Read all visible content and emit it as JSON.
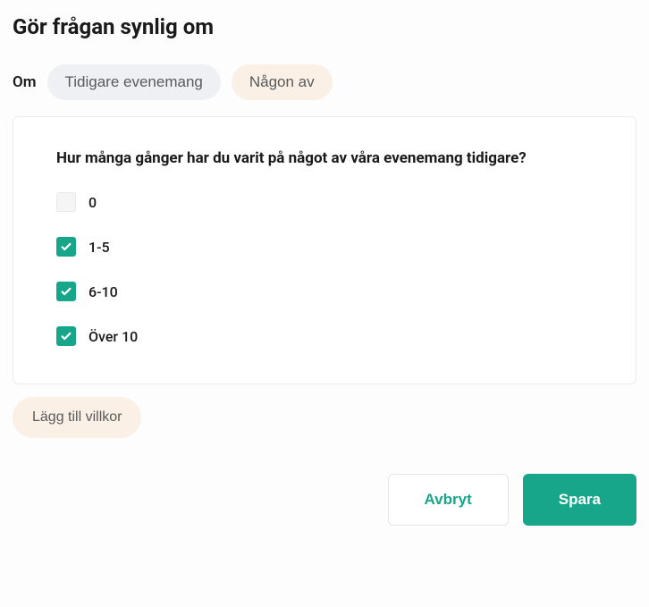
{
  "heading": "Gör frågan synlig om",
  "condition": {
    "prefix": "Om",
    "field": "Tidigare evenemang",
    "operator": "Någon av"
  },
  "question": "Hur många gånger har du varit på något av våra evenemang tidigare?",
  "options": [
    {
      "label": "0",
      "checked": false
    },
    {
      "label": "1-5",
      "checked": true
    },
    {
      "label": "6-10",
      "checked": true
    },
    {
      "label": "Över 10",
      "checked": true
    }
  ],
  "addConditionLabel": "Lägg till villkor",
  "footer": {
    "cancel": "Avbryt",
    "save": "Spara"
  }
}
